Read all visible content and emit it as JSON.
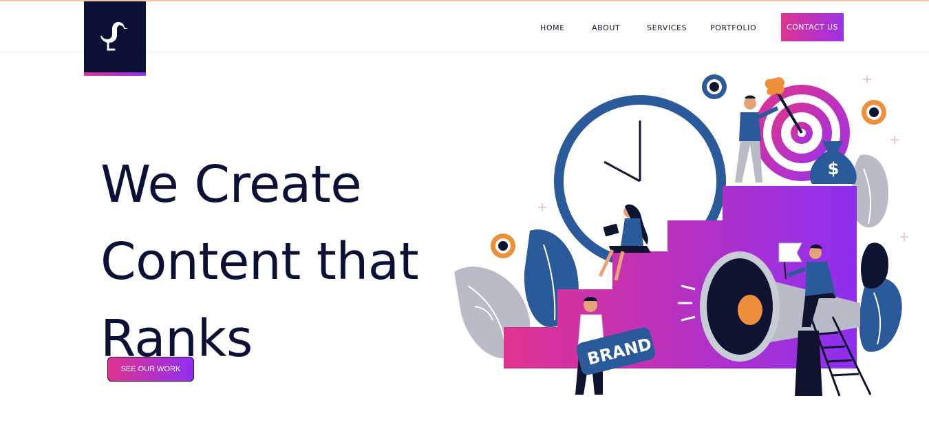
{
  "nav": {
    "items": [
      {
        "label": "HOME"
      },
      {
        "label": "ABOUT"
      },
      {
        "label": "SERVICES"
      },
      {
        "label": "PORTFOLIO"
      }
    ],
    "contact_label": "CONTACT US"
  },
  "hero": {
    "headline_lines": [
      "We Create",
      "Content that",
      "Ranks"
    ],
    "cta_label": "SEE OUR WORK"
  },
  "illustration": {
    "sign_text": "BRAND",
    "money_symbol": "$"
  },
  "colors": {
    "brand_navy": "#0b1035",
    "gradient_start": "#e0338f",
    "gradient_end": "#8e2ff0",
    "accent_orange": "#ee8f3b",
    "accent_blue": "#2a5a9a"
  }
}
